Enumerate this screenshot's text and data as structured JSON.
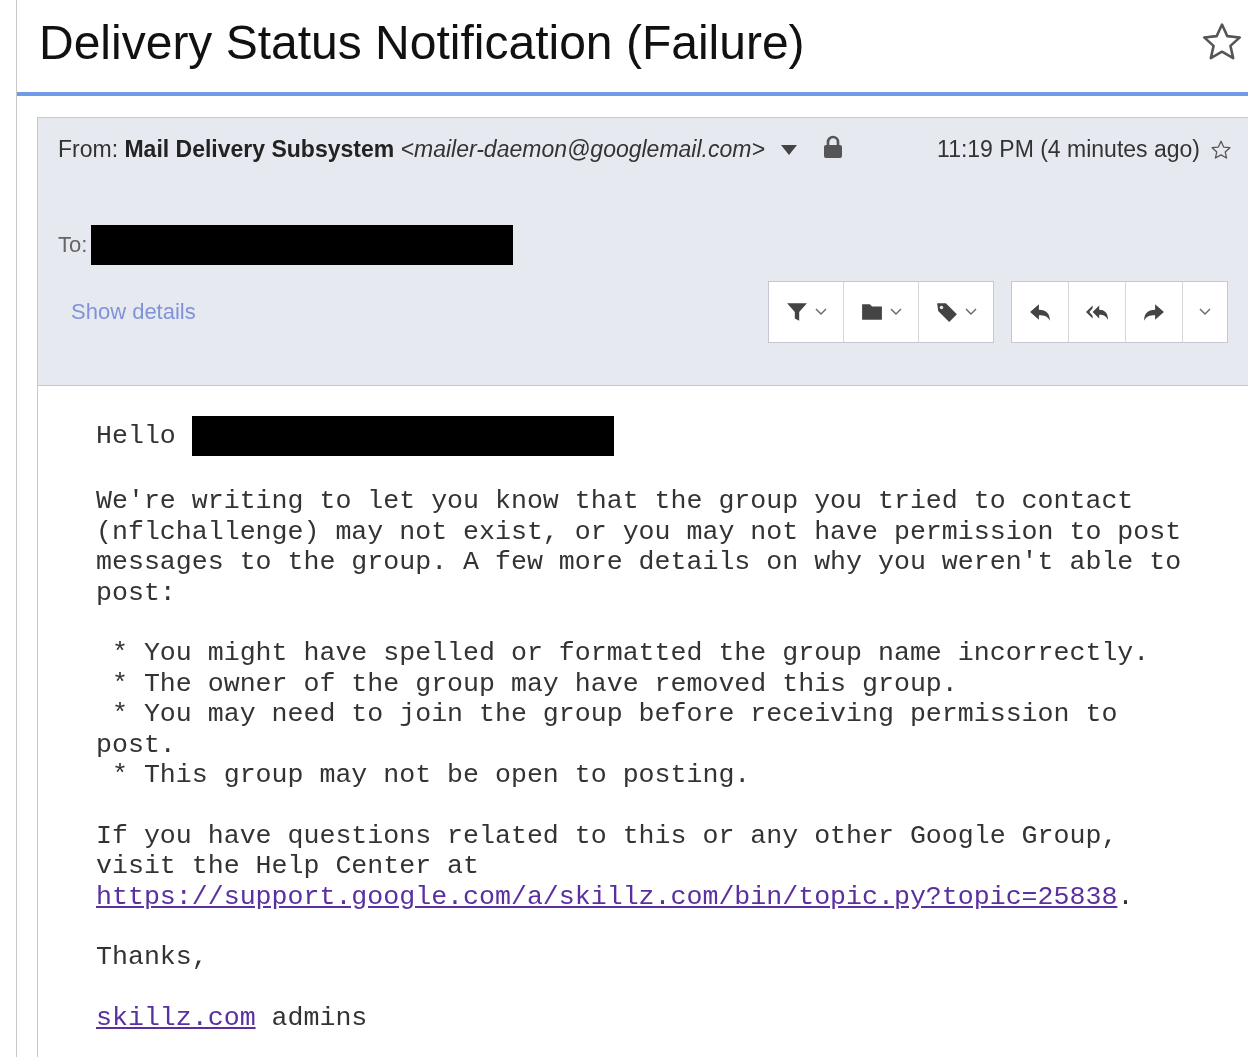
{
  "subject": "Delivery Status Notification (Failure)",
  "starred": false,
  "header": {
    "from_label": "From:",
    "sender_name": "Mail Delivery Subsystem",
    "sender_email": "<mailer-daemon@googlemail.com>",
    "time": "11:19 PM (4 minutes ago)",
    "starred": false,
    "to_label": "To:",
    "to_redacted": true,
    "show_details": "Show details",
    "toolbar": [
      [
        {
          "kind": "filter",
          "menu": true
        },
        {
          "kind": "folder",
          "menu": true
        },
        {
          "kind": "tag",
          "menu": true
        }
      ],
      [
        {
          "kind": "reply",
          "menu": false
        },
        {
          "kind": "reply-all",
          "menu": false
        },
        {
          "kind": "forward",
          "menu": false
        },
        {
          "kind": "more",
          "menu": true
        }
      ]
    ]
  },
  "body": [
    [
      {
        "kind": "text",
        "text": "Hello "
      },
      {
        "kind": "redacted"
      }
    ],
    [
      {
        "kind": "text",
        "text": "We're writing to let you know that the group you tried to contact\n(nflchallenge) may not exist, or you may not have permission to post\nmessages to the group. A few more details on why you weren't able to\npost:"
      }
    ],
    [
      {
        "kind": "text",
        "text": " * You might have spelled or formatted the group name incorrectly."
      }
    ],
    [
      {
        "kind": "text",
        "text": " * The owner of the group may have removed this group."
      }
    ],
    [
      {
        "kind": "text",
        "text": " * You may need to join the group before receiving permission to\npost."
      }
    ],
    [
      {
        "kind": "text",
        "text": " * This group may not be open to posting."
      }
    ],
    [
      {
        "kind": "text",
        "text": "If you have questions related to this or any other Google Group,\nvisit the Help Center at\n"
      },
      {
        "kind": "link",
        "text": "https://support.google.com/a/skillz.com/bin/topic.py?topic=25838"
      },
      {
        "kind": "text",
        "text": "."
      }
    ],
    [
      {
        "kind": "text",
        "text": "Thanks,"
      }
    ],
    [
      {
        "kind": "link",
        "text": "skillz.com"
      },
      {
        "kind": "text",
        "text": " admins"
      }
    ]
  ]
}
